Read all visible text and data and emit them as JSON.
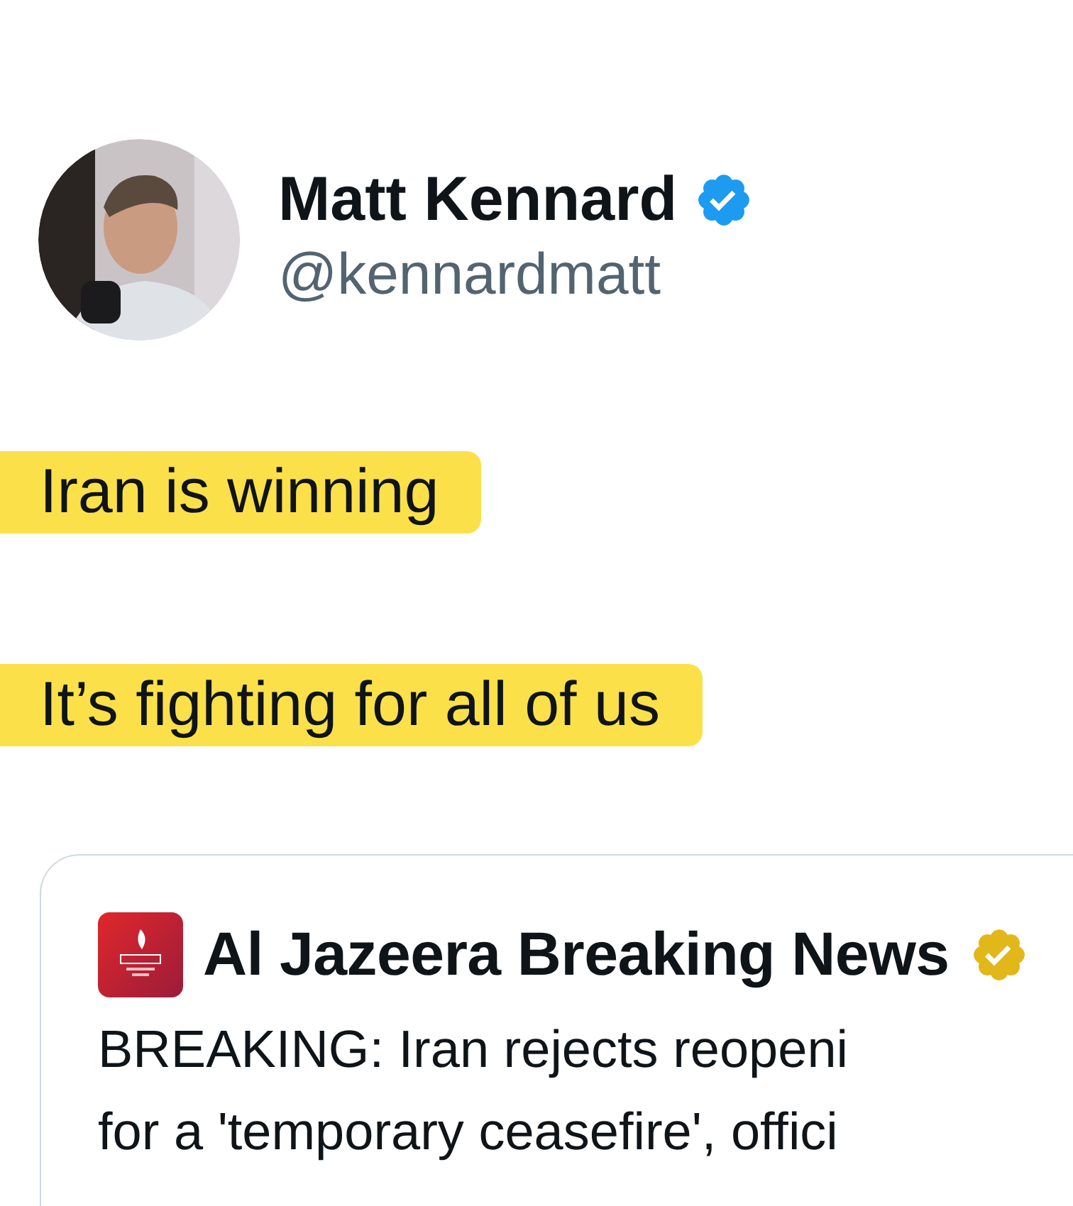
{
  "author": {
    "name": "Matt Kennard",
    "verified": true,
    "color": "#1d9bf0",
    "handle": "@kennardmatt"
  },
  "lines": [
    {
      "text": "Iran is winning",
      "highlighted": true
    },
    {
      "text": "It’s fighting for all of us",
      "highlighted": true
    }
  ],
  "quote": {
    "name": "Al Jazeera Breaking News",
    "verified": true,
    "color": "#e2b719",
    "lines": [
      "BREAKING: Iran rejects reopeni",
      "for a 'temporary ceasefire', offici"
    ]
  }
}
